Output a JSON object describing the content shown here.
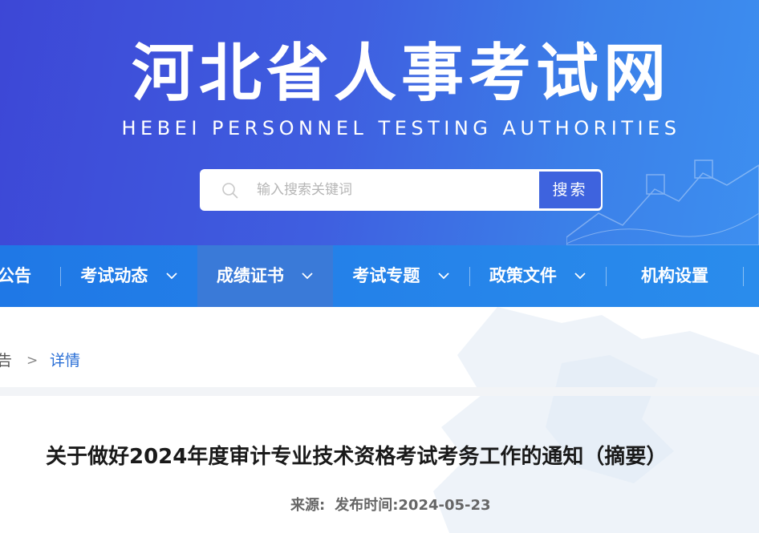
{
  "header": {
    "title": "河北省人事考试网",
    "subtitle": "HEBEI PERSONNEL TESTING AUTHORITIES"
  },
  "search": {
    "placeholder": "输入搜索关键词",
    "button_label": "搜索"
  },
  "nav": {
    "items": [
      {
        "label": "公告",
        "has_dropdown": false
      },
      {
        "label": "考试动态",
        "has_dropdown": true
      },
      {
        "label": "成绩证书",
        "has_dropdown": true,
        "active": true
      },
      {
        "label": "考试专题",
        "has_dropdown": true
      },
      {
        "label": "政策文件",
        "has_dropdown": true
      },
      {
        "label": "机构设置",
        "has_dropdown": false
      }
    ]
  },
  "breadcrumb": {
    "prev": "告",
    "separator": ">",
    "current": "详情"
  },
  "article": {
    "title": "关于做好2024年度审计专业技术资格考试考务工作的通知（摘要）",
    "source_label": "来源:",
    "published_label": "发布时间:",
    "published_date": "2024-05-23"
  },
  "colors": {
    "header_gradient_start": "#3d47d6",
    "header_gradient_end": "#3d8ff0",
    "nav_background": "#1f78e6",
    "nav_active": "#3a7ad8",
    "search_button": "#3e63de",
    "breadcrumb_current": "#2a6fd6"
  },
  "icons": {
    "search": "search-icon",
    "dropdown": "chevron-down-icon"
  }
}
